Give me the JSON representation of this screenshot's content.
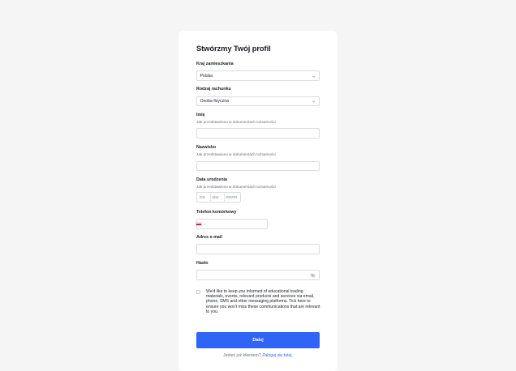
{
  "form": {
    "title": "Stwórzmy Twój profil",
    "country": {
      "label": "Kraj zamieszkania",
      "value": "Polska"
    },
    "account_type": {
      "label": "Rodzaj rachunku",
      "value": "Osoba fizyczna"
    },
    "first_name": {
      "label": "Imię",
      "hint": "Jak przedstawiono w dokumentach tożsamości",
      "value": ""
    },
    "last_name": {
      "label": "Nazwisko",
      "hint": "Jak przedstawiono w dokumentach tożsamości",
      "value": ""
    },
    "birth_date": {
      "label": "Data urodzenia",
      "hint": "Jak przedstawiono w dokumentach tożsamości",
      "placeholders": {
        "day": "DD",
        "month": "MM",
        "year": "RRRR"
      }
    },
    "phone": {
      "label": "Telefon komórkowy",
      "value": ""
    },
    "email": {
      "label": "Adres e-mail",
      "value": ""
    },
    "password": {
      "label": "Hasło",
      "value": ""
    },
    "consent_text": "We'd like to keep you informed of educational trading materials, events, relevant products and services via email, phone, SMS and other messaging platforms. Tick here to ensure you won't miss these communications that are relevant to you.",
    "submit_label": "Dalej",
    "login_prompt": "Jesteś już klientem?",
    "login_link": "Zaloguj się tutaj."
  },
  "colors": {
    "accent": "#2f65f6",
    "page_bg": "#f5f5f6",
    "card_bg": "#ffffff",
    "border": "#d9dbe0"
  },
  "icons": {
    "select": "chevron-down-icon",
    "password_toggle": "eye-off-icon",
    "phone_country": "poland-flag-icon"
  }
}
